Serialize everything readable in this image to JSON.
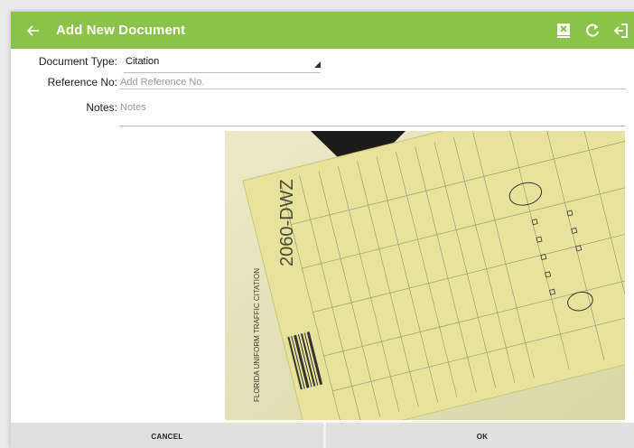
{
  "colors": {
    "toolbar": "#8bc34a",
    "toolbar_text": "#ffffff"
  },
  "toolbar": {
    "back_icon": "arrow-left-icon",
    "title": "Add New Document",
    "icons": [
      "close-box-icon",
      "refresh-icon",
      "logout-icon"
    ]
  },
  "form": {
    "document_type_label": "Document Type:",
    "document_type_value": "Citation",
    "reference_label": "Reference No:",
    "reference_placeholder": "Add Reference No.",
    "notes_label": "Notes:",
    "notes_placeholder": "Notes"
  },
  "photo": {
    "text_1": "2060-DWZ",
    "text_2": "FLORIDA UNIFORM TRAFFIC CITATION"
  },
  "buttons": {
    "cancel": "CANCEL",
    "ok": "OK"
  }
}
